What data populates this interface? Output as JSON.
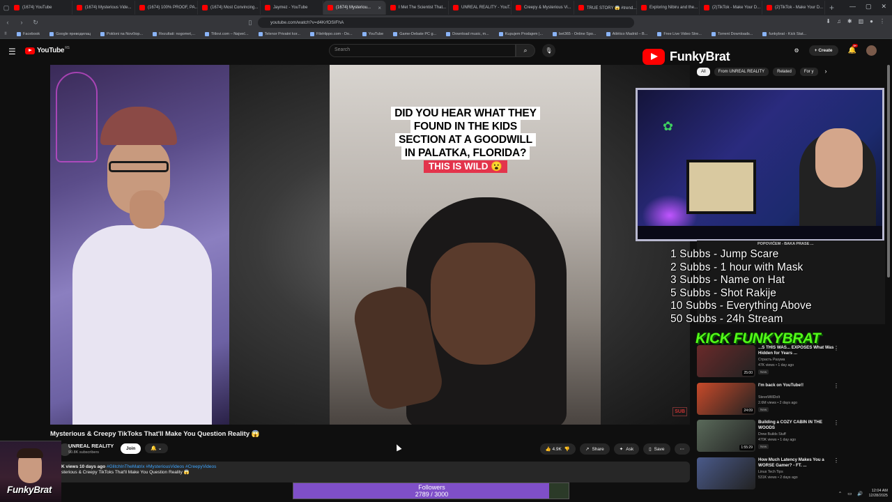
{
  "browser": {
    "tabs": [
      {
        "label": "(1674) YouTube",
        "active": false
      },
      {
        "label": "(1674) Mysterious Vide...",
        "active": false
      },
      {
        "label": "(1674) 100% PROOF, PA...",
        "active": false
      },
      {
        "label": "(1674) Most Convincing...",
        "active": false
      },
      {
        "label": "Jaymez - YouTube",
        "active": false
      },
      {
        "label": "(1674) Mysteriou...",
        "active": true
      },
      {
        "label": "I Met The Scientist That...",
        "active": false
      },
      {
        "label": "UNREAL REALITY - YouT...",
        "active": false
      },
      {
        "label": "Creepy & Mysterious Vi...",
        "active": false
      },
      {
        "label": "TRUE STORY 😱 #trend...",
        "active": false
      },
      {
        "label": "Exploring Nibiru and the...",
        "active": false
      },
      {
        "label": "(2)TikTok - Make Your D...",
        "active": false
      },
      {
        "label": "(2)TikTok - Make Your D...",
        "active": false
      }
    ],
    "url": "youtube.com/watch?v=d4KrfOSIFhA",
    "bookmarks": [
      "Facebook",
      "Google преводилац",
      "Pokloni na Novčtop...",
      "Rezultati: nogomet,...",
      "Titlovi.com – Najveć...",
      "Telenor Privatni kor...",
      "FileHippo.com - Do...",
      "YouTube",
      "Game-Debate PC g...",
      "Download music, m...",
      "Kupujem Prodajem |...",
      "bet365 - Online Spo...",
      "Atlético Madrid – B...",
      "Free Live Video Stre...",
      "Torrent Downloads...",
      "funkybrat - Kick Stat..."
    ]
  },
  "youtube": {
    "logo": "YouTube",
    "region": "RS",
    "search_placeholder": "Search",
    "create_label": "Create",
    "notif_count": "9+"
  },
  "video": {
    "tiktok_caption_lines": [
      "DID YOU HEAR WHAT THEY",
      "FOUND IN THE KIDS",
      "SECTION AT A GOODWILL",
      "IN PALATKA, FLORIDA?"
    ],
    "tiktok_wild": "THIS IS WILD 😮",
    "sub_watermark": "SUB",
    "title": "Mysterious & Creepy TikToks That'll Make You Question Reality 😱",
    "channel": "UNREAL REALITY",
    "subscribers": "90.8K subscribers",
    "join_label": "Join",
    "likes": "4.9K",
    "share_label": "Share",
    "ask_label": "Ask",
    "save_label": "Save",
    "desc_meta": "K views  10 days ago",
    "desc_tags": "#GlitchInTheMatrix #MysteriousVideos #CreepyVideos",
    "desc_text": "sterious & Creepy TikToks That'll Make You Question Reality 😱"
  },
  "sidebar": {
    "chips": [
      {
        "label": "All",
        "on": true
      },
      {
        "label": "From UNREAL REALITY",
        "on": false
      },
      {
        "label": "Related",
        "on": false
      },
      {
        "label": "For y",
        "on": false
      }
    ],
    "hidden_title": "POPOVIĆEM - BAKA PRASE ...",
    "recommendations": [
      {
        "title": "...S THIS WAS... EXPOSES What Was Hidden for Years ...",
        "channel": "Страсть Разума",
        "stats": "47K views • 1 day ago",
        "badge": "New",
        "duration": "25:00"
      },
      {
        "title": "I'm back on YouTube!!",
        "channel": "SteveWillDoIt",
        "stats": "2.6M views • 2 days ago",
        "badge": "New",
        "duration": "24:09"
      },
      {
        "title": "Building a COZY CABIN IN THE WOODS",
        "channel": "Drew Builds Stuff",
        "stats": "470K views • 1 day ago",
        "badge": "New",
        "duration": "1:55:29"
      },
      {
        "title": "How Much Latency Makes You a WORSE Gamer? - FT. ...",
        "channel": "Linus Tech Tips",
        "stats": "531K views • 2 days ago",
        "badge": "",
        "duration": ""
      }
    ]
  },
  "overlay": {
    "brand": "FunkyBrat",
    "goals": [
      "1 Subbs - Jump Scare",
      "2 Subbs - 1 hour with Mask",
      "3 Subbs - Name on Hat",
      "5 Subbs - Shot Rakije",
      "10 Subbs - Everything Above",
      "50 Subbs - 24h Stream"
    ],
    "kick_label": "KICK FUNKYBRAT",
    "streamer_name": "FunkyBrat",
    "followers_label": "Followers",
    "followers_count": "2789 / 3000",
    "followers_current": 2789,
    "followers_goal": 3000
  },
  "system": {
    "time": "12:04 AM",
    "date": "12/28/2025"
  },
  "colors": {
    "yt_red": "#ff0000",
    "followers_fill": "#7f4fc8",
    "kick_green": "#53fc18"
  }
}
